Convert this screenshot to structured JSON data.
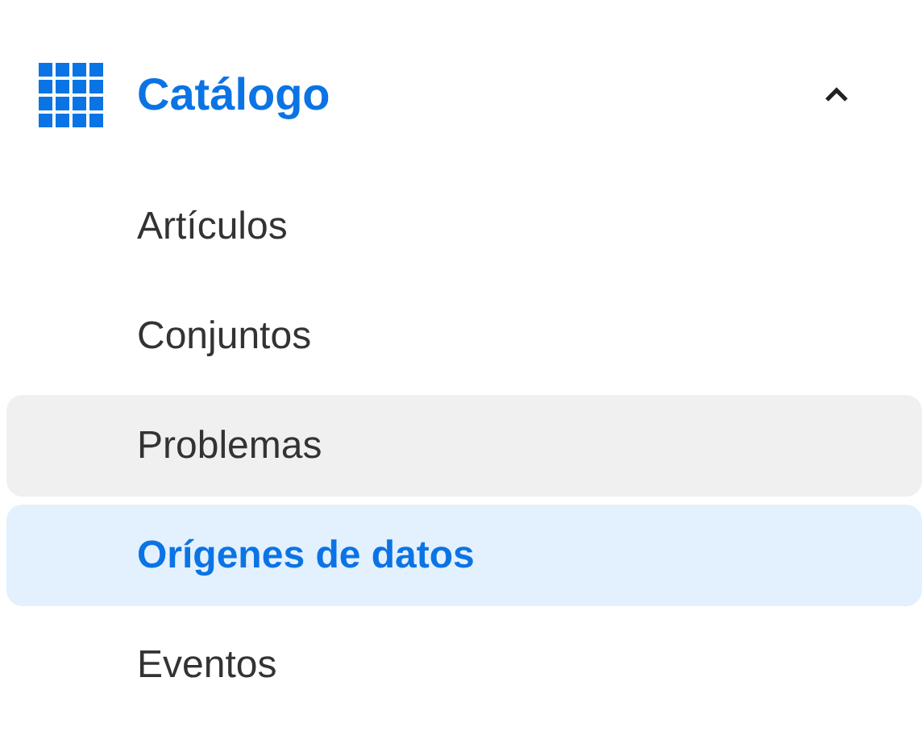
{
  "section": {
    "title": "Catálogo",
    "expanded": true,
    "items": [
      {
        "label": "Artículos",
        "selected": false,
        "hovered": false
      },
      {
        "label": "Conjuntos",
        "selected": false,
        "hovered": false
      },
      {
        "label": "Problemas",
        "selected": false,
        "hovered": true
      },
      {
        "label": "Orígenes de datos",
        "selected": true,
        "hovered": false
      },
      {
        "label": "Eventos",
        "selected": false,
        "hovered": false
      }
    ]
  }
}
